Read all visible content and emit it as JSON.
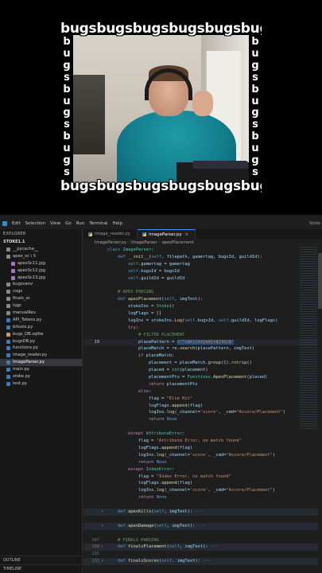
{
  "webcam": {
    "watermark_row": "bugsbugsbugsbugsbugsbugs",
    "watermark_col": [
      "b",
      "u",
      "g",
      "s",
      "b",
      "u",
      "g",
      "s",
      "b",
      "u",
      "g",
      "s"
    ]
  },
  "menubar": {
    "items": [
      "Edit",
      "Selection",
      "View",
      "Go",
      "Run",
      "Terminal",
      "Help"
    ],
    "right": "Stoke"
  },
  "sidebar": {
    "header": "EXPLORER",
    "root": "STOKE1.1",
    "items": [
      {
        "label": "__pycache__",
        "color": "#8a8a8a",
        "indent": false
      },
      {
        "label": "apex_sc \\ 5",
        "color": "#8a8a8a",
        "indent": false
      },
      {
        "label": "apexSc11.jpg",
        "color": "#a074c4",
        "indent": true
      },
      {
        "label": "apexSc12.jpg",
        "color": "#a074c4",
        "indent": true
      },
      {
        "label": "apexSc13.jpg",
        "color": "#a074c4",
        "indent": true
      },
      {
        "label": "bugsvenv",
        "color": "#8a8a8a",
        "indent": false
      },
      {
        "label": "cogs",
        "color": "#8a8a8a",
        "indent": false
      },
      {
        "label": "finals_sc",
        "color": "#8a8a8a",
        "indent": false
      },
      {
        "label": "logs",
        "color": "#8a8a8a",
        "indent": false
      },
      {
        "label": "manualRev",
        "color": "#8a8a8a",
        "indent": false
      },
      {
        "label": "API_Tokens.py",
        "color": "#3a7abf",
        "indent": false
      },
      {
        "label": "bitools.py",
        "color": "#3a7abf",
        "indent": false
      },
      {
        "label": "bugs_DB.sqlite",
        "color": "#d19a66",
        "indent": false
      },
      {
        "label": "bugsDB.py",
        "color": "#3a7abf",
        "indent": false
      },
      {
        "label": "functions.py",
        "color": "#3a7abf",
        "indent": false
      },
      {
        "label": "image_reader.py",
        "color": "#3a7abf",
        "indent": false
      },
      {
        "label": "ImageParser.py",
        "color": "#3a7abf",
        "indent": false,
        "selected": true
      },
      {
        "label": "main.py",
        "color": "#3a7abf",
        "indent": false
      },
      {
        "label": "stoke.py",
        "color": "#3a7abf",
        "indent": false
      },
      {
        "label": "test.py",
        "color": "#3a7abf",
        "indent": false
      }
    ],
    "outline": "OUTLINE",
    "timeline": "TIMELINE"
  },
  "tabs": [
    {
      "label": "image_reader.py",
      "active": false
    },
    {
      "label": "ImageParser.py",
      "active": true
    }
  ],
  "breadcrumb": [
    "ImageParser.py",
    "ImageParser",
    "apexPlacement"
  ],
  "code_lines": [
    {
      "n": "",
      "fold": "",
      "html": "<span class=\"kw\">class</span> <span class=\"cls\">ImageParser</span>:"
    },
    {
      "n": "",
      "fold": "",
      "html": "    <span class=\"kw\">def</span> <span class=\"fn\">__init__</span>(<span class=\"self\">self</span>, <span class=\"var\">filepath</span>, <span class=\"var\">gamertag</span>, <span class=\"var\">bugsId</span>, <span class=\"var\">guildId</span>):"
    },
    {
      "n": "",
      "fold": "",
      "html": "        <span class=\"self\">self</span>.<span class=\"var\">gamertag</span> = <span class=\"var\">gamertag</span>"
    },
    {
      "n": "",
      "fold": "",
      "html": "        <span class=\"self\">self</span>.<span class=\"var\">bugsId</span> = <span class=\"var\">bugsId</span>"
    },
    {
      "n": "",
      "fold": "",
      "html": "        <span class=\"self\">self</span>.<span class=\"var\">guildId</span> = <span class=\"var\">guildId</span>"
    },
    {
      "n": "",
      "fold": "",
      "html": ""
    },
    {
      "n": "",
      "fold": "",
      "html": "    <span class=\"cm\"># APEX PARSING</span>"
    },
    {
      "n": "",
      "fold": "",
      "html": "    <span class=\"kw\">def</span> <span class=\"fn\">apexPlacement</span>(<span class=\"self\">self</span>, <span class=\"var\">imgText</span>):"
    },
    {
      "n": "",
      "fold": "",
      "html": "        <span class=\"var\">stokeIns</span> = <span class=\"cls\">Stoke</span>()"
    },
    {
      "n": "",
      "fold": "",
      "html": "        <span class=\"var\">logFlags</span> = []"
    },
    {
      "n": "",
      "fold": "",
      "html": "        <span class=\"var\">logIns</span> = <span class=\"var\">stokeIns</span>.<span class=\"fn\">Log</span>(<span class=\"self\">self</span>.<span class=\"var\">bugsId</span>, <span class=\"self\">self</span>.<span class=\"var\">guildId</span>, <span class=\"var\">logFlags</span>)"
    },
    {
      "n": "",
      "fold": "",
      "html": "        <span class=\"kw2\">try</span>:"
    },
    {
      "n": "",
      "fold": "",
      "html": "            <span class=\"cm\"># FILTER PLACEMENT</span>"
    },
    {
      "n": "19",
      "fold": "",
      "cur": true,
      "html": "            <span class=\"var\">placePattern</span> = <span class=\"sel-str\">r'^(d+)(st|nd|rd|th)$'</span>"
    },
    {
      "n": "",
      "fold": "",
      "html": "            <span class=\"var\">placeMatch</span> = <span class=\"var\">re</span>.<span class=\"fn\">search</span>(<span class=\"var\">placePattern</span>, <span class=\"var\">imgText</span>)"
    },
    {
      "n": "",
      "fold": "",
      "html": "            <span class=\"kw2\">if</span> <span class=\"var\">placeMatch</span>:"
    },
    {
      "n": "",
      "fold": "",
      "html": "                <span class=\"var\">placement</span> = <span class=\"var\">placeMatch</span>.<span class=\"fn\">group</span>(<span class=\"num\">1</span>).<span class=\"fn\">rstrip</span>()"
    },
    {
      "n": "",
      "fold": "",
      "html": "                <span class=\"var\">placed</span> = <span class=\"cls\">int</span>(<span class=\"var\">placement</span>)"
    },
    {
      "n": "",
      "fold": "",
      "html": "                <span class=\"var\">placementPts</span> = <span class=\"cls\">Functions</span>.<span class=\"fn\">ApexPlacement</span>(<span class=\"var\">placed</span>)"
    },
    {
      "n": "",
      "fold": "",
      "html": "                <span class=\"kw2\">return</span> <span class=\"var\">placementPts</span>"
    },
    {
      "n": "",
      "fold": "",
      "html": "            <span class=\"kw2\">else</span>:"
    },
    {
      "n": "",
      "fold": "",
      "html": "                <span class=\"var\">flag</span> = <span class=\"str\">\"Else Hit\"</span>"
    },
    {
      "n": "",
      "fold": "",
      "html": "                <span class=\"var\">logFlags</span>.<span class=\"fn\">append</span>(<span class=\"var\">flag</span>)"
    },
    {
      "n": "",
      "fold": "",
      "html": "                <span class=\"var\">logIns</span>.<span class=\"fn\">log</span>(<span class=\"var\">_channel</span>=<span class=\"str\">'score'</span>, <span class=\"var\">_cmd</span>=<span class=\"str\">\"Ascore/Placement\"</span>)"
    },
    {
      "n": "",
      "fold": "",
      "html": "                <span class=\"kw2\">return</span> <span class=\"kw\">None</span>"
    },
    {
      "n": "",
      "fold": "",
      "html": ""
    },
    {
      "n": "",
      "fold": "",
      "html": "        <span class=\"kw2\">except</span> <span class=\"cls\">AttributeError</span>:"
    },
    {
      "n": "",
      "fold": "",
      "html": "            <span class=\"var\">flag</span> = <span class=\"str\">\"Attribute Error, no match found\"</span>"
    },
    {
      "n": "",
      "fold": "",
      "html": "            <span class=\"var\">logFlags</span>.<span class=\"fn\">append</span>(<span class=\"var\">flag</span>)"
    },
    {
      "n": "",
      "fold": "",
      "html": "            <span class=\"var\">logIns</span>.<span class=\"fn\">log</span>(<span class=\"var\">_channel</span>=<span class=\"str\">'score'</span>, <span class=\"var\">_cmd</span>=<span class=\"str\">\"Ascore/Placement\"</span>)"
    },
    {
      "n": "",
      "fold": "",
      "html": "            <span class=\"kw2\">return</span> <span class=\"kw\">None</span>"
    },
    {
      "n": "",
      "fold": "",
      "html": "        <span class=\"kw2\">except</span> <span class=\"cls\">IndexError</span>:"
    },
    {
      "n": "",
      "fold": "",
      "html": "            <span class=\"var\">flag</span> = <span class=\"str\">\"Index Error, no match found\"</span>"
    },
    {
      "n": "",
      "fold": "",
      "html": "            <span class=\"var\">logFlags</span>.<span class=\"fn\">append</span>(<span class=\"var\">flag</span>)"
    },
    {
      "n": "",
      "fold": "",
      "html": "            <span class=\"var\">logIns</span>.<span class=\"fn\">log</span>(<span class=\"var\">_channel</span>=<span class=\"str\">'score'</span>, <span class=\"var\">_cmd</span>=<span class=\"str\">\"Ascore/Placement\"</span>)"
    },
    {
      "n": "",
      "fold": "",
      "html": "            <span class=\"kw2\">return</span> <span class=\"kw\">None</span>"
    },
    {
      "n": "",
      "fold": "",
      "html": ""
    },
    {
      "n": "",
      "fold": "›",
      "folded": true,
      "html": "    <span class=\"kw\">def</span> <span class=\"fn\">apexKills</span>(<span class=\"self\">self</span>, <span class=\"var\">imgText</span>): <span class=\"ell\">···</span>"
    },
    {
      "n": "",
      "fold": "",
      "html": ""
    },
    {
      "n": "",
      "fold": "›",
      "folded": true,
      "html": "    <span class=\"kw\">def</span> <span class=\"fn\">apexDamage</span>(<span class=\"self\">self</span>, <span class=\"var\">imgText</span>): <span class=\"ell\">···</span>"
    },
    {
      "n": "",
      "fold": "",
      "html": ""
    },
    {
      "n": "107",
      "fold": "",
      "html": "    <span class=\"cm\"># FINALS PARSING</span>"
    },
    {
      "n": "108",
      "fold": "›",
      "folded": true,
      "html": "    <span class=\"kw\">def</span> <span class=\"fn\">finalsPlacement</span>(<span class=\"self\">self</span>, <span class=\"var\">imgText</span>): <span class=\"ell\">···</span>"
    },
    {
      "n": "131",
      "fold": "",
      "html": ""
    },
    {
      "n": "132",
      "fold": "›",
      "folded": true,
      "html": "    <span class=\"kw\">def</span> <span class=\"fn\">finalsScores</span>(<span class=\"self\">self</span>, <span class=\"var\">imgText</span>): <span class=\"ell\">···</span>"
    }
  ]
}
